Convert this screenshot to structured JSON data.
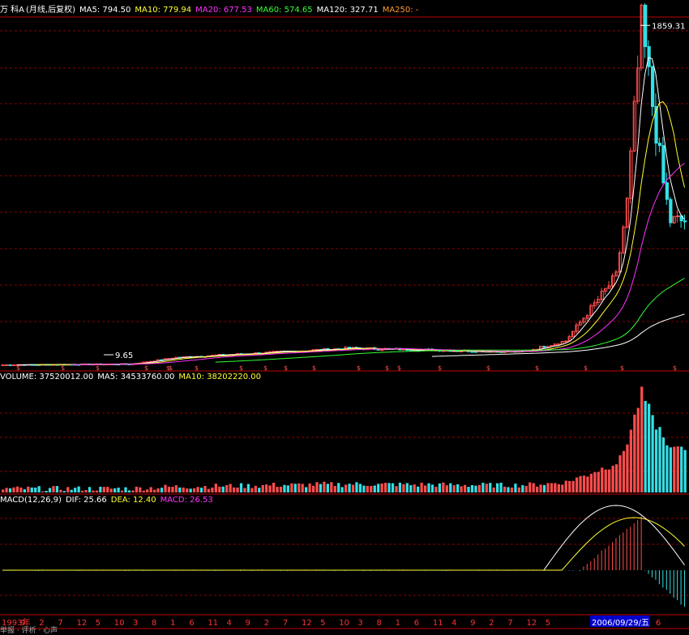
{
  "colors": {
    "background": "#000000",
    "grid": "#8b0000",
    "border": "#c00000",
    "up": "#ff4d4d",
    "down": "#33e0e6",
    "text": "#ffffff",
    "ma5": "#ffffff",
    "ma10": "#ffff33",
    "ma20": "#ff33ff",
    "ma60": "#33ff33",
    "ma120": "#ffffff",
    "ma250": "#ff9933",
    "axis_label": "#ff3030",
    "date_highlight_bg": "#0000cc"
  },
  "price_header": {
    "title": "万 科A",
    "subtitle": "(月线,后复权)",
    "ma5": "MA5: 794.50",
    "ma10": "MA10: 779.94",
    "ma20": "MA20: 677.53",
    "ma60": "MA60: 574.65",
    "ma120": "MA120: 327.71",
    "ma250": "MA250: -"
  },
  "volume_header": {
    "volume": "VOLUME: 37520012.00",
    "ma5": "MA5: 34533760.00",
    "ma10": "MA10: 38202220.00"
  },
  "macd_header": {
    "label": "MACD(12,26,9)",
    "dif": "DIF: 25.66",
    "dea": "DEA: 12.40",
    "macd": "MACD: 26.53"
  },
  "price_labels": {
    "high": "1859.31",
    "low": "9.65"
  },
  "date_axis": {
    "labels": [
      "1993年",
      "9",
      "2",
      "7",
      "12",
      "5",
      "10",
      "3",
      "8",
      "1",
      "6",
      "11",
      "4",
      "9",
      "2",
      "7",
      "12",
      "5",
      "10",
      "3",
      "8",
      "1",
      "6",
      "11",
      "4",
      "9",
      "2",
      "7",
      "12",
      "5",
      "1",
      "6"
    ],
    "highlight": "2006/09/29/五"
  },
  "bottom_cut_text": "举报 · 评析 · 心声",
  "chart_data": {
    "type": "candlestick",
    "title": "万 科A (月线,后复权)",
    "period": "monthly",
    "x_range": [
      "1993",
      "2008"
    ],
    "price_ylim": [
      0,
      1900
    ],
    "annotations": {
      "max": 1859.31,
      "min": 9.65
    },
    "approx_price_path": [
      {
        "x": "1993",
        "close": 20
      },
      {
        "x": "1996",
        "close": 25
      },
      {
        "x": "1997",
        "close": 60
      },
      {
        "x": "2001",
        "close": 110
      },
      {
        "x": "2005",
        "close": 90
      },
      {
        "x": "2006",
        "close": 150
      },
      {
        "x": "2007-03",
        "close": 500
      },
      {
        "x": "2007-06",
        "close": 900
      },
      {
        "x": "2007-10",
        "close": 1859.31
      },
      {
        "x": "2008-04",
        "close": 1000
      },
      {
        "x": "2008-06",
        "close": 800
      }
    ],
    "moving_averages": [
      {
        "name": "MA5",
        "last": 794.5
      },
      {
        "name": "MA10",
        "last": 779.94
      },
      {
        "name": "MA20",
        "last": 677.53
      },
      {
        "name": "MA60",
        "last": 574.65
      },
      {
        "name": "MA120",
        "last": 327.71
      },
      {
        "name": "MA250",
        "last": null
      }
    ],
    "volume": {
      "last": 37520012.0,
      "ma5": 34533760.0,
      "ma10": 38202220.0
    },
    "macd": {
      "params": "12,26,9",
      "dif": 25.66,
      "dea": 12.4,
      "macd": 26.53
    }
  }
}
